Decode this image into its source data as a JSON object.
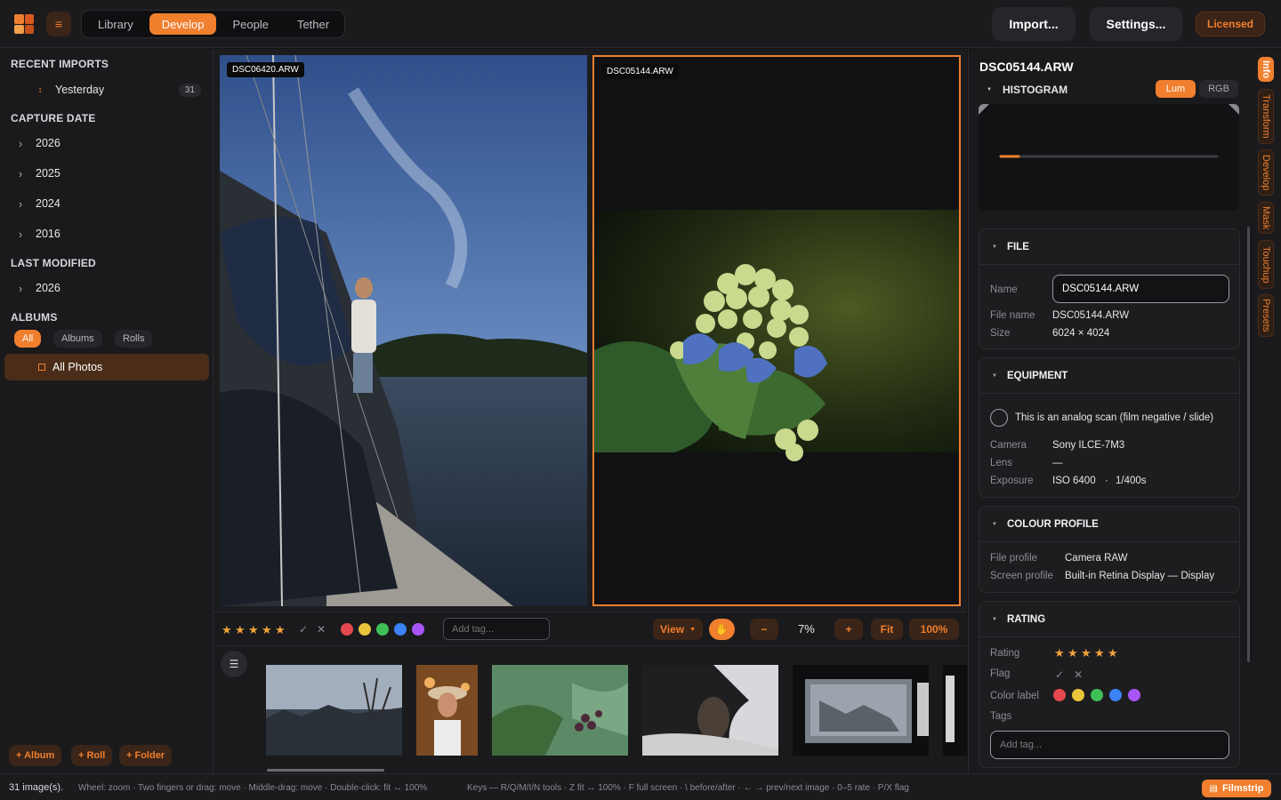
{
  "topbar": {
    "menu_icon": "menu-icon",
    "tabs": [
      {
        "label": "Library",
        "active": false
      },
      {
        "label": "Develop",
        "active": true
      },
      {
        "label": "People",
        "active": false
      },
      {
        "label": "Tether",
        "active": false
      }
    ],
    "import_label": "Import...",
    "settings_label": "Settings...",
    "licensed_label": "Licensed"
  },
  "sidebar": {
    "recent_imports_title": "RECENT IMPORTS",
    "recent_imports": [
      {
        "label": "Yesterday",
        "count": "31"
      }
    ],
    "capture_date_title": "CAPTURE DATE",
    "capture_years": [
      "2026",
      "2025",
      "2024",
      "2016"
    ],
    "last_modified_title": "LAST MODIFIED",
    "modified_years": [
      "2026"
    ],
    "albums_title": "ALBUMS",
    "album_filters": [
      {
        "label": "All",
        "active": true
      },
      {
        "label": "Albums",
        "active": false
      },
      {
        "label": "Rolls",
        "active": false
      }
    ],
    "selected_album": "All Photos",
    "add_buttons": [
      "+ Album",
      "+ Roll",
      "+ Folder"
    ]
  },
  "viewer": {
    "left_filename": "DSC06420.ARW",
    "right_filename": "DSC05144.ARW"
  },
  "toolbar": {
    "rating_stars": "★",
    "flag_pick": "✓",
    "flag_reject": "✕",
    "color_labels": [
      "#e5484d",
      "#e9c53b",
      "#3fbf57",
      "#3b82f6",
      "#a855f7"
    ],
    "tag_placeholder": "Add tag...",
    "view_label": "View",
    "zoom_out": "−",
    "zoom_value": "7%",
    "zoom_in": "+",
    "fit_label": "Fit",
    "full_label": "100%"
  },
  "right_panel": {
    "title": "DSC05144.ARW",
    "histogram_title": "HISTOGRAM",
    "histogram_modes": [
      {
        "label": "Lum",
        "active": true
      },
      {
        "label": "RGB",
        "active": false
      }
    ],
    "file_section": {
      "title": "FILE",
      "name_label": "Name",
      "name_value": "DSC05144.ARW",
      "filename_label": "File name",
      "filename_value": "DSC05144.ARW",
      "size_label": "Size",
      "size_value": "6024 × 4024"
    },
    "equipment_section": {
      "title": "EQUIPMENT",
      "analog_label": "This is an analog scan (film negative / slide)",
      "camera_label": "Camera",
      "camera_value": "Sony ILCE-7M3",
      "lens_label": "Lens",
      "lens_value": "—",
      "exposure_label": "Exposure",
      "exposure_iso": "ISO 6400",
      "exposure_sep": "·",
      "exposure_shutter": "1/400s"
    },
    "colour_section": {
      "title": "COLOUR PROFILE",
      "file_profile_label": "File profile",
      "file_profile_value": "Camera RAW",
      "screen_profile_label": "Screen profile",
      "screen_profile_value": "Built-in Retina Display — Display"
    },
    "rating_section": {
      "title": "RATING",
      "rating_label": "Rating",
      "flag_label": "Flag",
      "color_label": "Color label",
      "tags_label": "Tags",
      "tag_placeholder": "Add tag..."
    }
  },
  "vertical_tabs": [
    {
      "label": "Info",
      "active": true
    },
    {
      "label": "Transform",
      "active": false
    },
    {
      "label": "Develop",
      "active": false
    },
    {
      "label": "Mask",
      "active": false
    },
    {
      "label": "Touchup",
      "active": false
    },
    {
      "label": "Presets",
      "active": false
    }
  ],
  "status": {
    "image_count": "31 image(s).",
    "hints": "Wheel: zoom · Two fingers or drag: move · Middle-drag: move · Double-click: fit ↔ 100%",
    "keys": "Keys — R/Q/M/I/N tools · Z fit ↔ 100% · F full screen · \\ before/after · ← → prev/next image · 0–5 rate · P/X flag",
    "filmstrip_label": "Filmstrip"
  }
}
